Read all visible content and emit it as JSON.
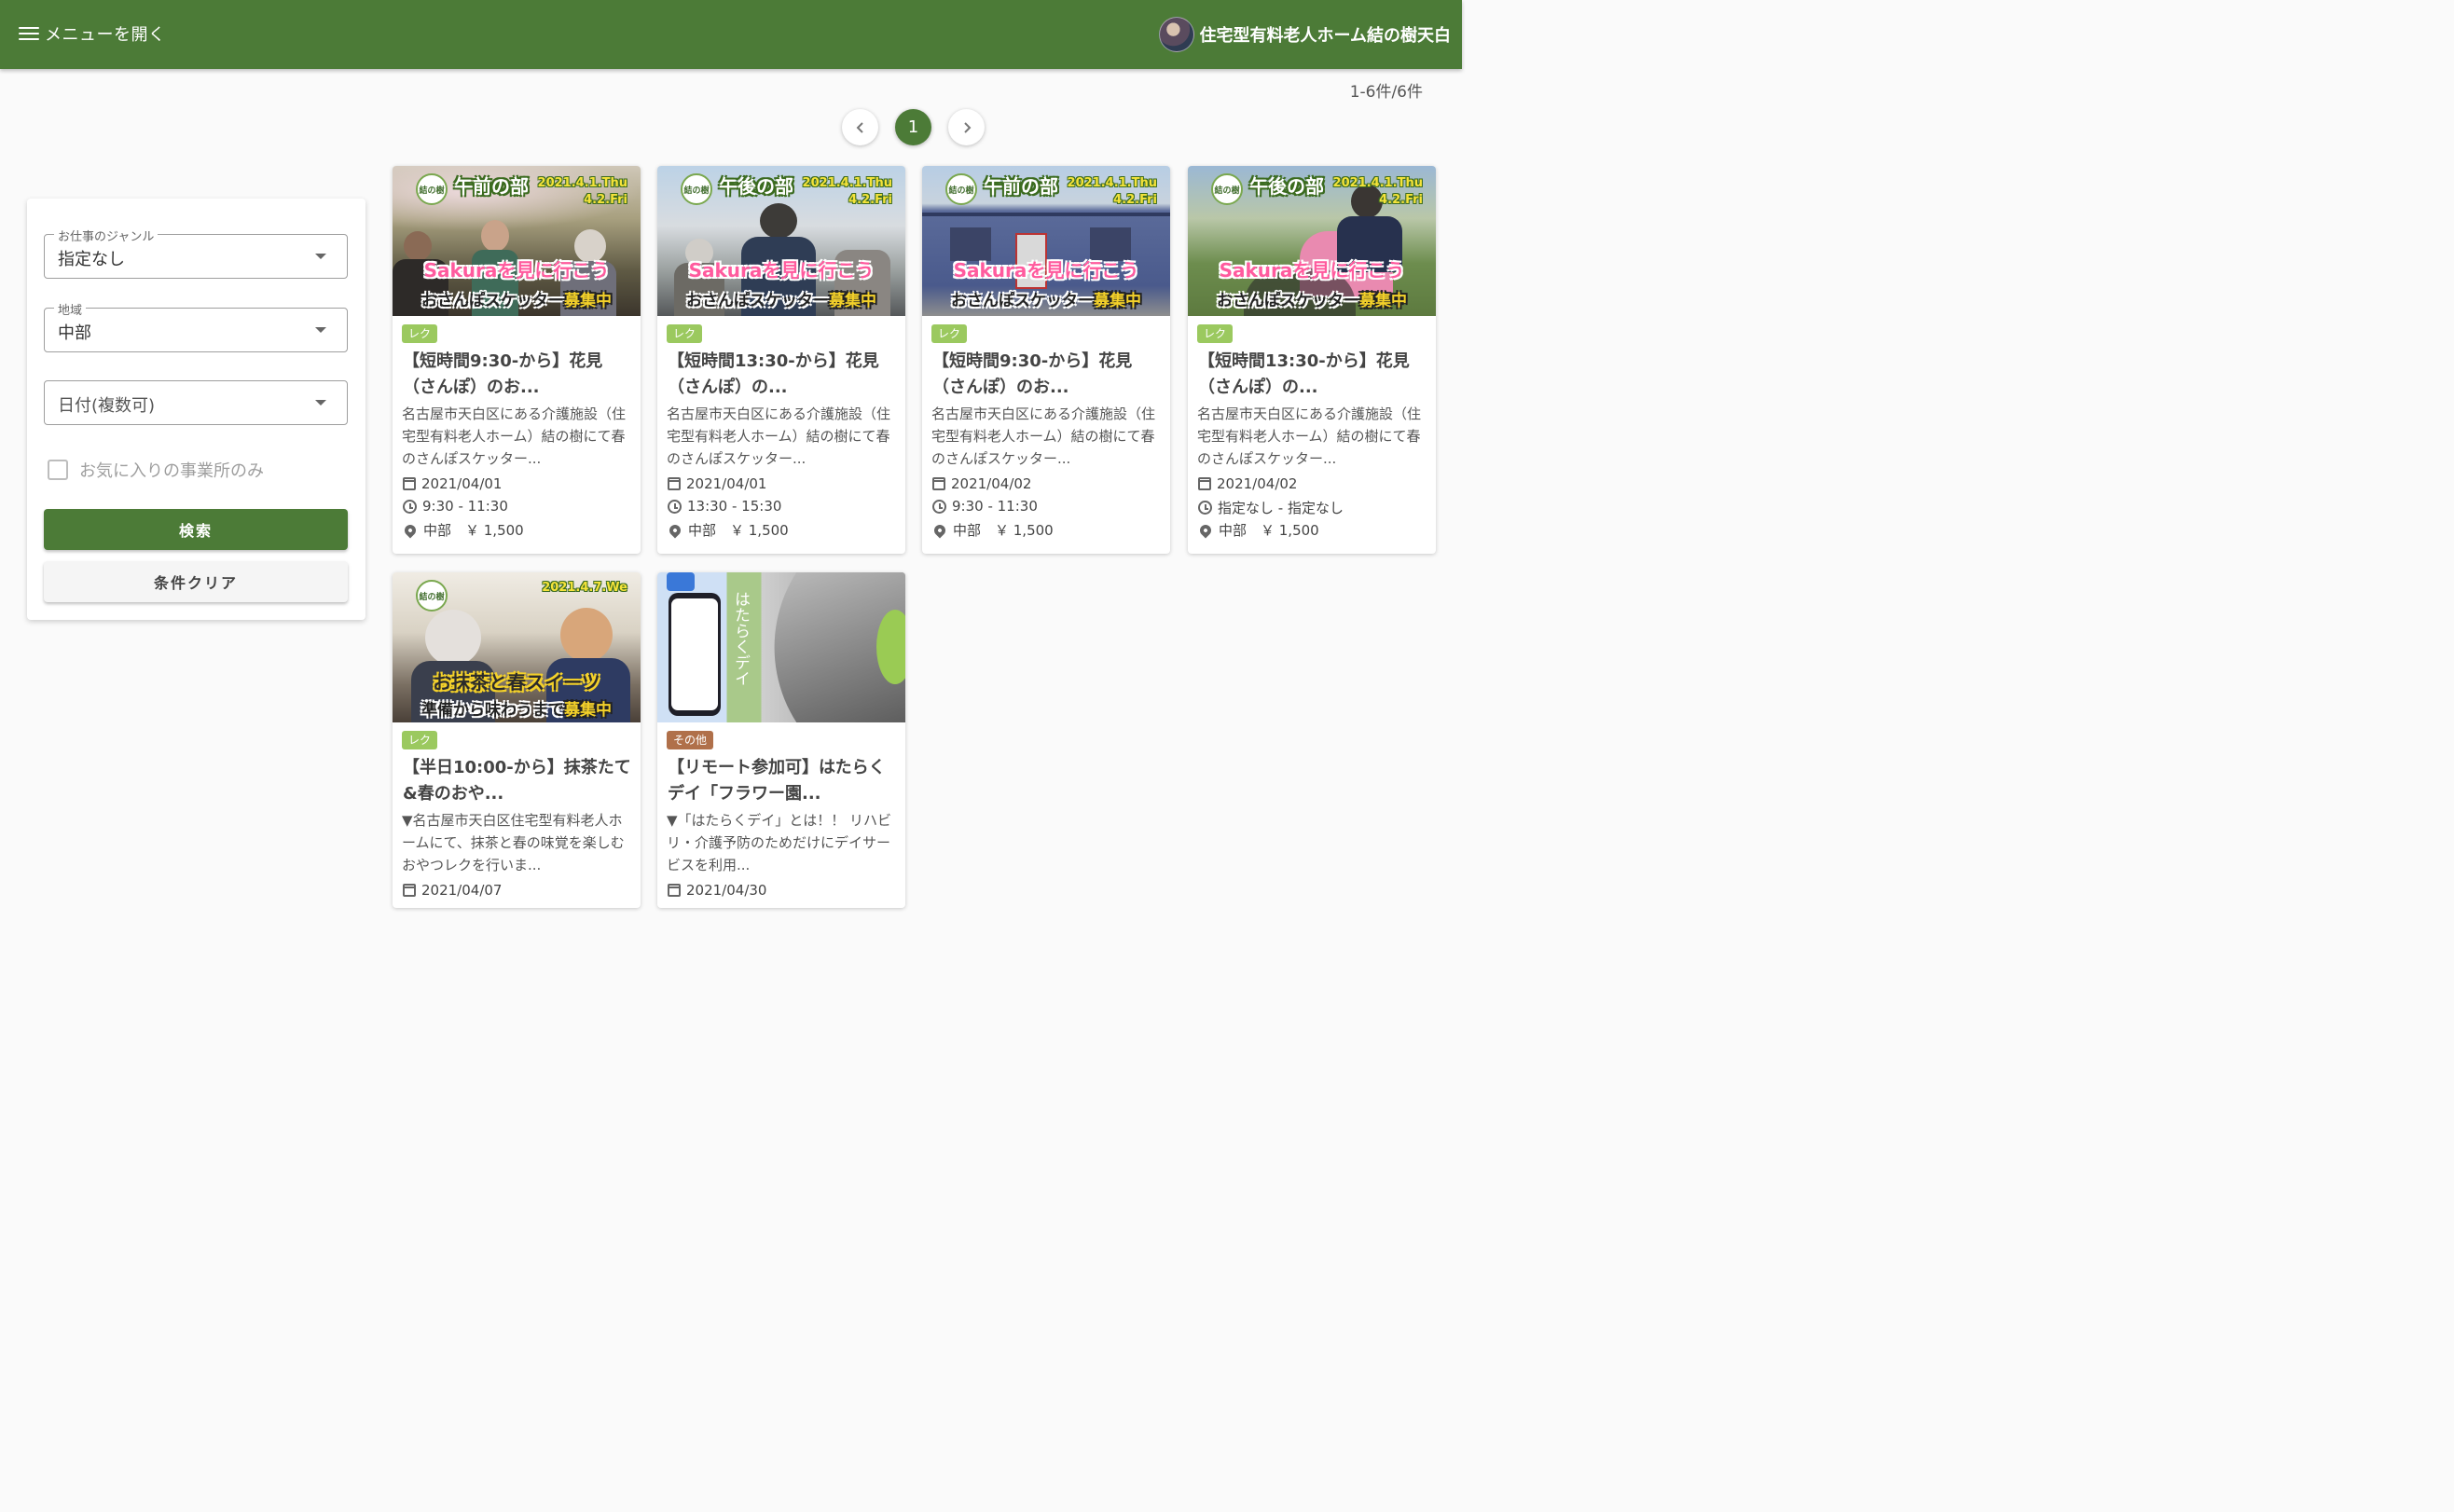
{
  "header": {
    "menu_label": "メニューを開く",
    "facility_name": "住宅型有料老人ホーム結の樹天白"
  },
  "results": {
    "count_label": "1-6件/6件"
  },
  "pagination": {
    "prev_icon": "chevron-left-icon",
    "current_page": "1",
    "next_icon": "chevron-right-icon"
  },
  "filters": {
    "genre": {
      "label": "お仕事のジャンル",
      "value": "指定なし"
    },
    "region": {
      "label": "地域",
      "value": "中部"
    },
    "date": {
      "placeholder": "日付(複数可)"
    },
    "favorites_only": {
      "label": "お気に入りの事業所のみ",
      "checked": false
    },
    "search_label": "検索",
    "clear_label": "条件クリア"
  },
  "cards": [
    {
      "banner": {
        "session": "午前の部",
        "date": "2021.4.1.Thu\n4.2.Fri",
        "main": "Sakuraを見に行こう",
        "sub": "おさんぽスケッター",
        "sub_highlight": "募集中"
      },
      "tag": "レク",
      "title": "【短時間9:30-から】花見（さんぽ）のお...",
      "desc": "名古屋市天白区にある介護施設（住宅型有料老人ホーム）結の樹にて春のさんぽスケッター...",
      "date": "2021/04/01",
      "time": "9:30 - 11:30",
      "location": "中部　￥ 1,500"
    },
    {
      "banner": {
        "session": "午後の部",
        "date": "2021.4.1.Thu\n4.2.Fri",
        "main": "Sakuraを見に行こう",
        "sub": "おさんぽスケッター",
        "sub_highlight": "募集中"
      },
      "tag": "レク",
      "title": "【短時間13:30-から】花見（さんぽ）の...",
      "desc": "名古屋市天白区にある介護施設（住宅型有料老人ホーム）結の樹にて春のさんぽスケッター...",
      "date": "2021/04/01",
      "time": "13:30 - 15:30",
      "location": "中部　￥ 1,500"
    },
    {
      "banner": {
        "session": "午前の部",
        "date": "2021.4.1.Thu\n4.2.Fri",
        "main": "Sakuraを見に行こう",
        "sub": "おさんぽスケッター",
        "sub_highlight": "募集中"
      },
      "tag": "レク",
      "title": "【短時間9:30-から】花見（さんぽ）のお...",
      "desc": "名古屋市天白区にある介護施設（住宅型有料老人ホーム）結の樹にて春のさんぽスケッター...",
      "date": "2021/04/02",
      "time": "9:30 - 11:30",
      "location": "中部　￥ 1,500"
    },
    {
      "banner": {
        "session": "午後の部",
        "date": "2021.4.1.Thu\n4.2.Fri",
        "main": "Sakuraを見に行こう",
        "sub": "おさんぽスケッター",
        "sub_highlight": "募集中"
      },
      "tag": "レク",
      "title": "【短時間13:30-から】花見（さんぽ）の...",
      "desc": "名古屋市天白区にある介護施設（住宅型有料老人ホーム）結の樹にて春のさんぽスケッター...",
      "date": "2021/04/02",
      "time": "指定なし - 指定なし",
      "location": "中部　￥ 1,500"
    },
    {
      "banner": {
        "date": "2021.4.7.We",
        "main": "お抹茶と春スイーツ",
        "sub": "準備から味わうまで",
        "sub_highlight": "募集中"
      },
      "tag": "レク",
      "title": "【半日10:00-から】抹茶たて&春のおや...",
      "desc": "▼名古屋市天白区住宅型有料老人ホームにて、抹茶と春の味覚を楽しむおやつレクを行いま...",
      "date": "2021/04/07"
    },
    {
      "banner": {
        "side": "はたらくデイ"
      },
      "tag": "その他",
      "title": "【リモート参加可】はたらくデイ「フラワー園...",
      "desc": "▼「はたらくデイ」とは！！ リハビリ・介護予防のためだけにデイサービスを利用...",
      "date": "2021/04/30"
    }
  ],
  "colors": {
    "brand_green": "#4c7b37",
    "tag_green": "#9bc95f",
    "tag_brown": "#b0704a"
  }
}
